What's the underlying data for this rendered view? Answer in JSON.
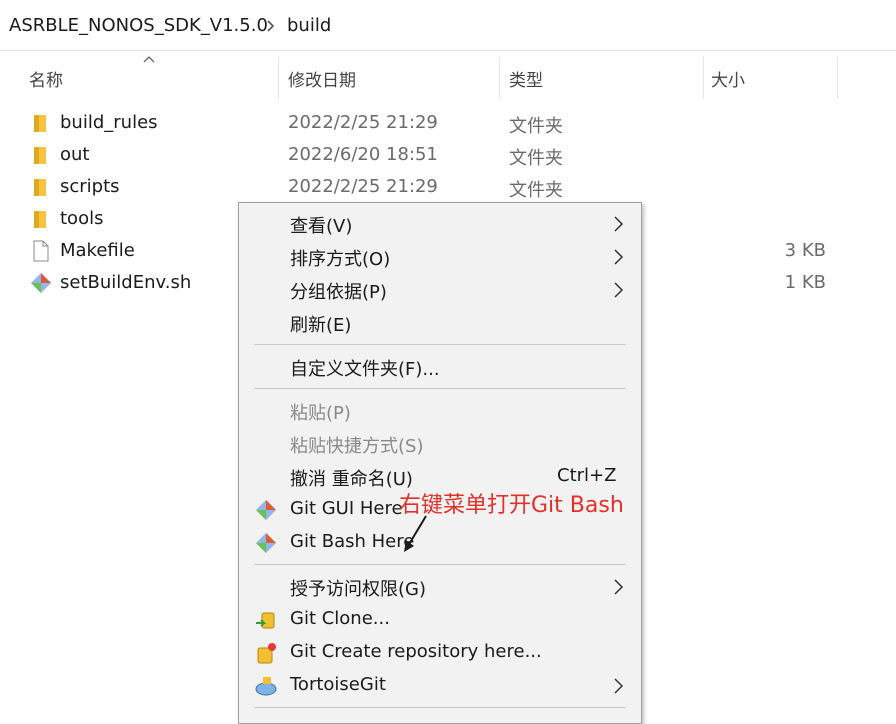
{
  "breadcrumb": {
    "root": "ASRBLE_NONOS_SDK_V1.5.0",
    "current": "build"
  },
  "columns": {
    "name": "名称",
    "date": "修改日期",
    "type": "类型",
    "size": "大小"
  },
  "files": [
    {
      "name": "build_rules",
      "date": "2022/2/25 21:29",
      "type": "文件夹",
      "size": "",
      "icon": "folder-icon"
    },
    {
      "name": "out",
      "date": "2022/6/20 18:51",
      "type": "文件夹",
      "size": "",
      "icon": "folder-icon"
    },
    {
      "name": "scripts",
      "date": "2022/2/25 21:29",
      "type": "文件夹",
      "size": "",
      "icon": "folder-icon"
    },
    {
      "name": "tools",
      "date": "",
      "type": "",
      "size": "",
      "icon": "folder-icon"
    },
    {
      "name": "Makefile",
      "date": "",
      "type": "",
      "size": "3 KB",
      "icon": "file-icon"
    },
    {
      "name": "setBuildEnv.sh",
      "date": "",
      "type": "",
      "size": "1 KB",
      "icon": "git-file-icon"
    }
  ],
  "context_menu": {
    "view": "查看(V)",
    "sort": "排序方式(O)",
    "group": "分组依据(P)",
    "refresh": "刷新(E)",
    "customize": "自定义文件夹(F)...",
    "paste": "粘贴(P)",
    "paste_shortcut": "粘贴快捷方式(S)",
    "undo_rename": "撤消 重命名(U)",
    "undo_shortcut": "Ctrl+Z",
    "git_gui": "Git GUI Here",
    "git_bash": "Git Bash Here",
    "grant_access": "授予访问权限(G)",
    "git_clone": "Git Clone...",
    "git_create": "Git Create repository here...",
    "tortoise": "TortoiseGit"
  },
  "annotation": "右键菜单打开Git Bash",
  "colors": {
    "annotation": "#e5302a",
    "folder": "#f5c542",
    "menu_bg": "#f2f2f2"
  }
}
